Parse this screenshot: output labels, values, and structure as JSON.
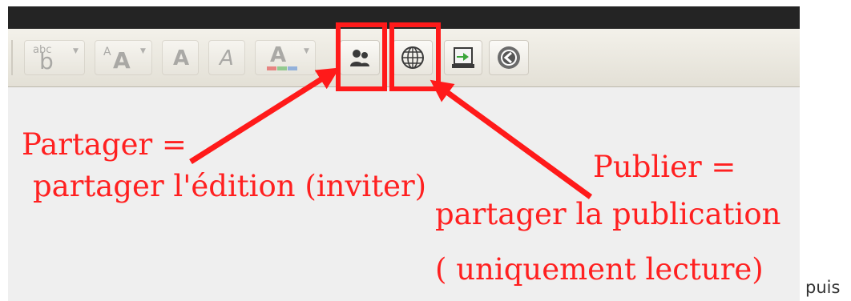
{
  "toolbar": {
    "buttons": [
      {
        "name": "superscript-subscript",
        "icon": "superscript-icon",
        "label": "abc"
      },
      {
        "name": "font-size",
        "icon": "font-size-icon",
        "label": "AA"
      },
      {
        "name": "bold",
        "icon": "bold-icon",
        "label": "A"
      },
      {
        "name": "italic",
        "icon": "italic-icon",
        "label": "A"
      },
      {
        "name": "text-color",
        "icon": "text-color-icon",
        "label": "A"
      },
      {
        "name": "share",
        "icon": "users-icon"
      },
      {
        "name": "publish",
        "icon": "globe-icon"
      },
      {
        "name": "export",
        "icon": "export-icon"
      },
      {
        "name": "back",
        "icon": "back-circle-icon"
      }
    ]
  },
  "annotations": {
    "share_title": "Partager =",
    "share_desc": "partager l'édition (inviter)",
    "publish_title": "Publier =",
    "publish_desc": "partager la publication",
    "publish_note": "( uniquement lecture)"
  },
  "footer_text": "puis",
  "colors": {
    "annotation": "#ff1a1a",
    "toolbar_bg": "#e9e6de",
    "top_band": "#242424",
    "canvas": "#efefef"
  }
}
